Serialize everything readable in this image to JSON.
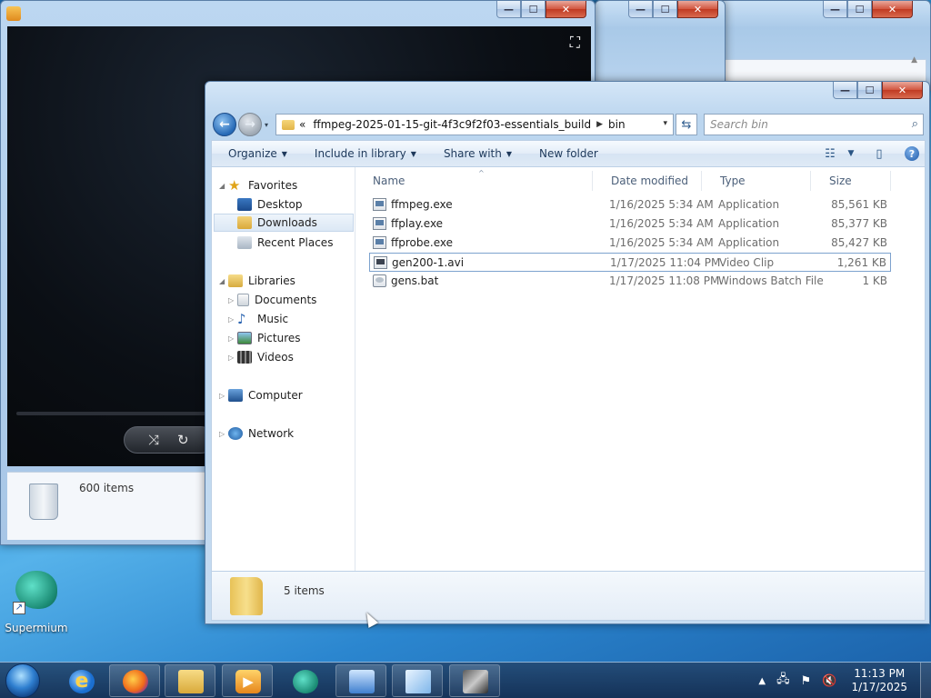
{
  "explorer": {
    "address_parts": [
      "«",
      "ffmpeg-2025-01-15-git-4f3c9f2f03-essentials_build",
      "bin"
    ],
    "search_placeholder": "Search bin",
    "toolbar": {
      "organize": "Organize",
      "include_in_library": "Include in library",
      "share_with": "Share with",
      "new_folder": "New folder"
    },
    "nav": {
      "favorites": "Favorites",
      "desktop": "Desktop",
      "downloads": "Downloads",
      "recent_places": "Recent Places",
      "libraries": "Libraries",
      "documents": "Documents",
      "music": "Music",
      "pictures": "Pictures",
      "videos": "Videos",
      "computer": "Computer",
      "network": "Network"
    },
    "columns": {
      "name": "Name",
      "date": "Date modified",
      "type": "Type",
      "size": "Size"
    },
    "files": [
      {
        "name": "ffmpeg.exe",
        "date": "1/16/2025 5:34 AM",
        "type": "Application",
        "size": "85,561 KB"
      },
      {
        "name": "ffplay.exe",
        "date": "1/16/2025 5:34 AM",
        "type": "Application",
        "size": "85,377 KB"
      },
      {
        "name": "ffprobe.exe",
        "date": "1/16/2025 5:34 AM",
        "type": "Application",
        "size": "85,427 KB"
      },
      {
        "name": "gen200-1.avi",
        "date": "1/17/2025 11:04 PM",
        "type": "Video Clip",
        "size": "1,261 KB"
      },
      {
        "name": "gens.bat",
        "date": "1/17/2025 11:08 PM",
        "type": "Windows Batch File",
        "size": "1 KB"
      }
    ],
    "status": "5 items"
  },
  "background_window": {
    "status": "600 items"
  },
  "desktop": {
    "icon_label": "Supermium"
  },
  "taskbar": {
    "time": "11:13 PM",
    "date": "1/17/2025"
  },
  "colors": {
    "accent": "#2669b6",
    "selection_border": "#7da2ce",
    "close_button": "#c03a22"
  }
}
